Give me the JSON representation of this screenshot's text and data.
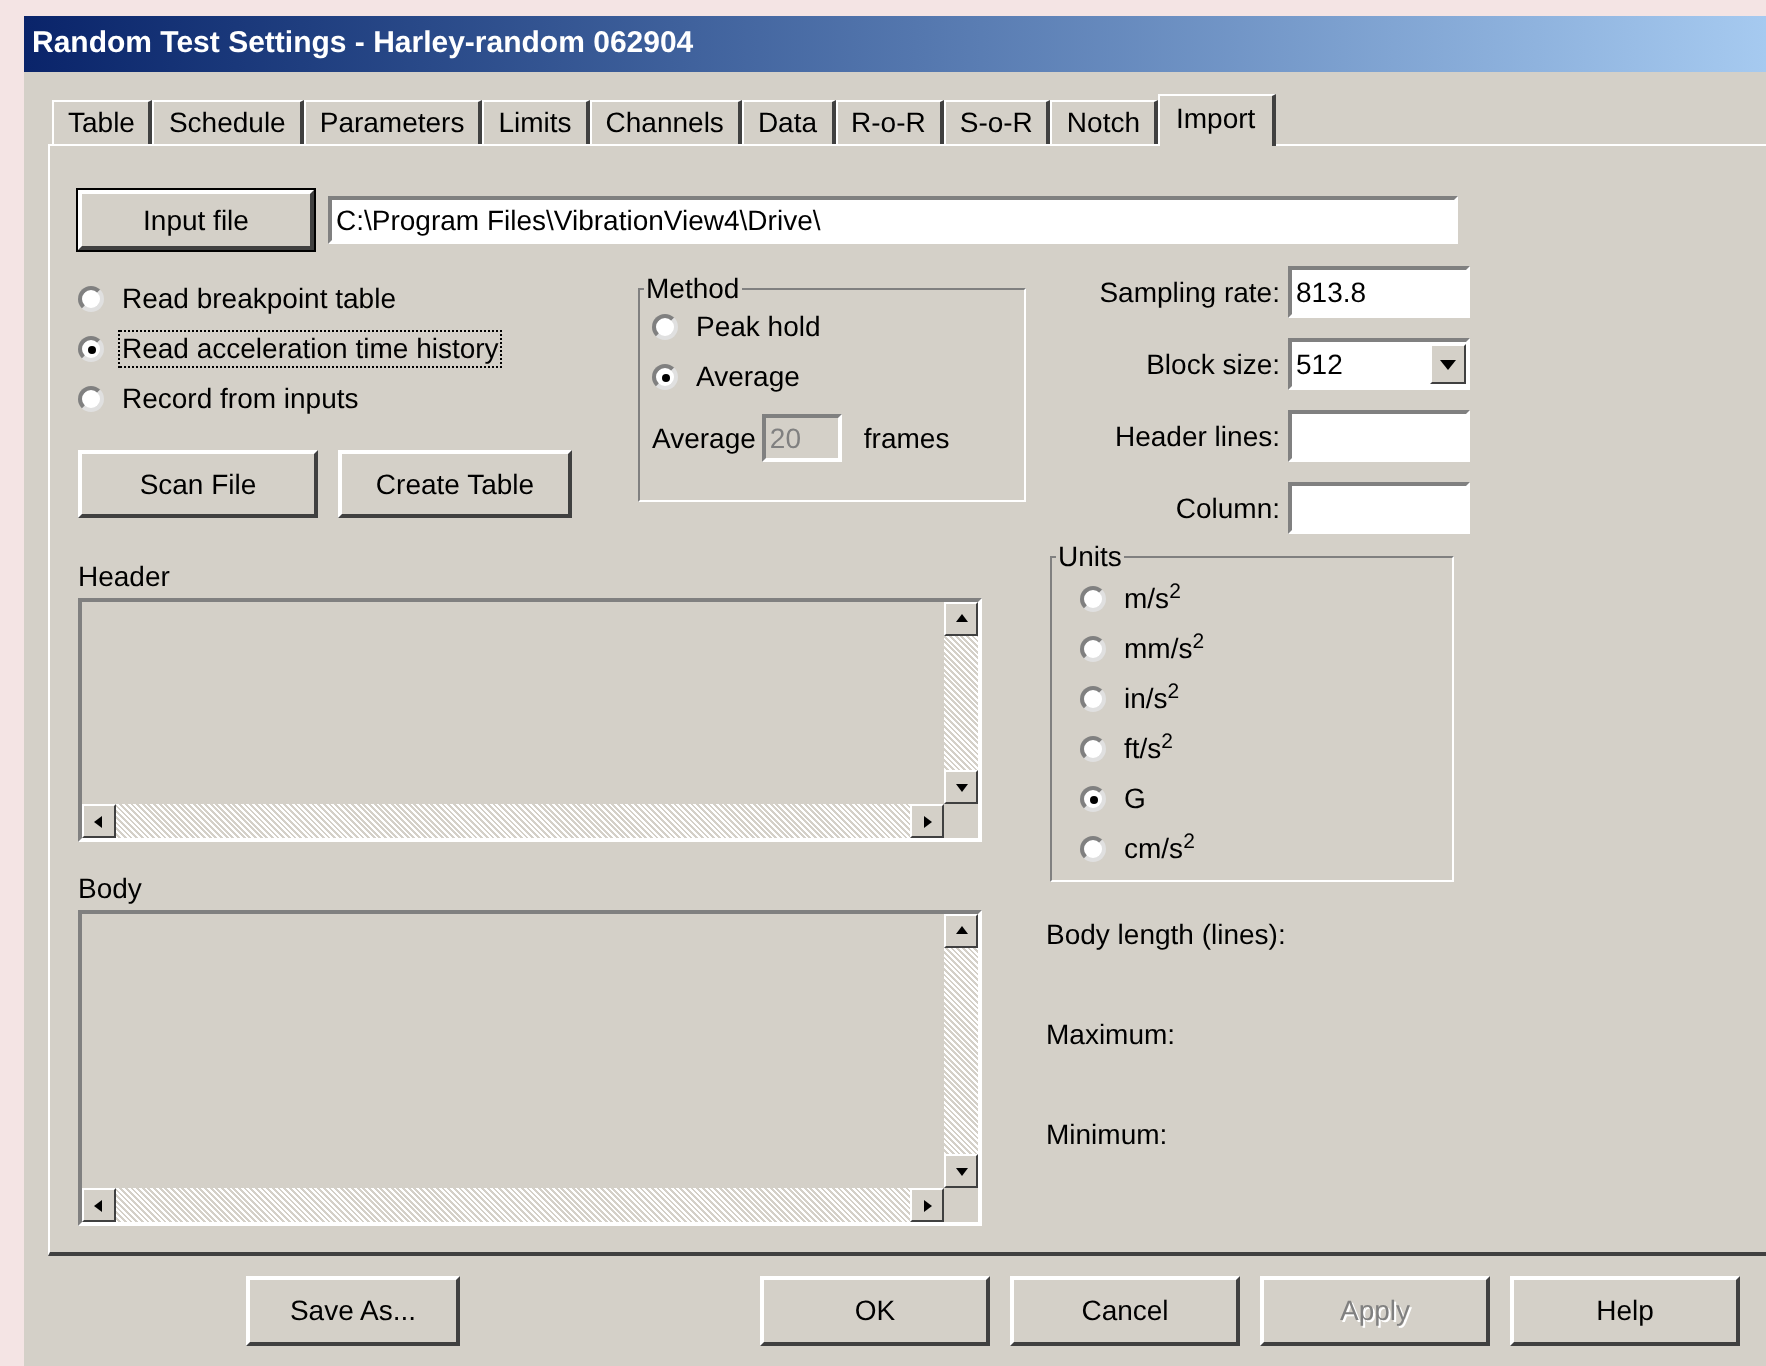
{
  "window": {
    "title": "Random Test Settings - Harley-random 062904"
  },
  "tabs": [
    {
      "label": "Table",
      "selected": false
    },
    {
      "label": "Schedule",
      "selected": false
    },
    {
      "label": "Parameters",
      "selected": false
    },
    {
      "label": "Limits",
      "selected": false
    },
    {
      "label": "Channels",
      "selected": false
    },
    {
      "label": "Data",
      "selected": false
    },
    {
      "label": "R-o-R",
      "selected": false
    },
    {
      "label": "S-o-R",
      "selected": false
    },
    {
      "label": "Notch",
      "selected": false
    },
    {
      "label": "Import",
      "selected": true
    }
  ],
  "input_file": {
    "button": "Input file",
    "path": "C:\\Program Files\\VibrationView4\\Drive\\"
  },
  "source_options": [
    {
      "label": "Read breakpoint table",
      "selected": false,
      "focused": false
    },
    {
      "label": "Read acceleration time history",
      "selected": true,
      "focused": true
    },
    {
      "label": "Record from inputs",
      "selected": false,
      "focused": false
    }
  ],
  "method": {
    "title": "Method",
    "options": [
      {
        "label": "Peak hold",
        "selected": false
      },
      {
        "label": "Average",
        "selected": true
      }
    ],
    "average_label": "Average",
    "average_value": "20",
    "average_disabled": true,
    "frames_label": "frames"
  },
  "action_buttons": [
    "Scan File",
    "Create Table"
  ],
  "header": {
    "label": "Header"
  },
  "body": {
    "label": "Body"
  },
  "fields": [
    {
      "label": "Sampling rate:",
      "value": "813.8",
      "kind": "text"
    },
    {
      "label": "Block size:",
      "value": "512",
      "kind": "dropdown"
    },
    {
      "label": "Header lines:",
      "kind": "text"
    },
    {
      "label": "Column:",
      "kind": "text"
    }
  ],
  "units": {
    "title": "Units",
    "options": [
      {
        "label": "m/s$^{2}$",
        "selected": false
      },
      {
        "label": "mm/s$^{2}$",
        "selected": false
      },
      {
        "label": "in/s$^{2}$",
        "selected": false
      },
      {
        "label": "ft/s$^{2}$",
        "selected": false
      },
      {
        "label": "G",
        "selected": true
      },
      {
        "label": "cm/s$^{2}$",
        "selected": false
      }
    ]
  },
  "stats": [
    "Body length (lines):",
    "Maximum:",
    "Minimum:"
  ],
  "buttons": [
    {
      "label": "Save As...",
      "disabled": false
    },
    {
      "label": "OK",
      "disabled": false
    },
    {
      "label": "Cancel",
      "disabled": false
    },
    {
      "label": "Apply",
      "disabled": true
    },
    {
      "label": "Help",
      "disabled": false
    }
  ]
}
